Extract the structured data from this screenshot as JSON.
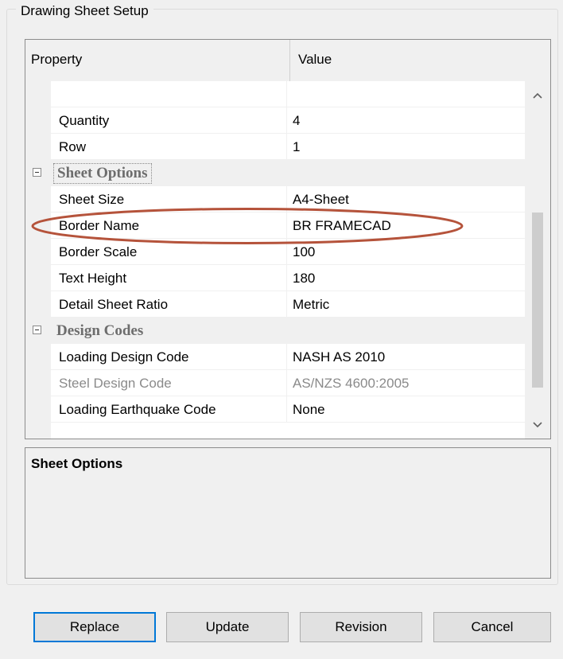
{
  "group": {
    "title": "Drawing Sheet Setup"
  },
  "grid": {
    "header": {
      "property": "Property",
      "value": "Value"
    },
    "rows": [
      {
        "type": "prop",
        "property": "",
        "value": ""
      },
      {
        "type": "prop",
        "property": "Quantity",
        "value": "4"
      },
      {
        "type": "prop",
        "property": "Row",
        "value": "1"
      },
      {
        "type": "category",
        "label": "Sheet Options",
        "expanded": true
      },
      {
        "type": "prop",
        "property": "Sheet Size",
        "value": "A4-Sheet"
      },
      {
        "type": "prop",
        "property": "Border Name",
        "value": "BR FRAMECAD",
        "highlighted": true
      },
      {
        "type": "prop",
        "property": "Border Scale",
        "value": "100"
      },
      {
        "type": "prop",
        "property": "Text Height",
        "value": "180"
      },
      {
        "type": "prop",
        "property": "Detail Sheet Ratio",
        "value": "Metric"
      },
      {
        "type": "category",
        "label": "Design Codes",
        "expanded": true
      },
      {
        "type": "prop",
        "property": "Loading Design Code",
        "value": "NASH AS 2010"
      },
      {
        "type": "prop",
        "property": "Steel Design Code",
        "value": "AS/NZS 4600:2005",
        "disabled": true
      },
      {
        "type": "prop",
        "property": "Loading Earthquake Code",
        "value": "None"
      }
    ]
  },
  "description": {
    "title": "Sheet Options"
  },
  "buttons": {
    "replace": "Replace",
    "update": "Update",
    "revision": "Revision",
    "cancel": "Cancel"
  },
  "icons": {
    "collapse": "minus-box-icon",
    "scroll_up": "chevron-up-icon",
    "scroll_down": "chevron-down-icon"
  },
  "colors": {
    "window_bg": "#f0f0f0",
    "category_text": "#6d6d6d",
    "disabled_text": "#8a8a8a",
    "highlight_ellipse": "#b5533b",
    "primary_button_border": "#0078d7"
  }
}
